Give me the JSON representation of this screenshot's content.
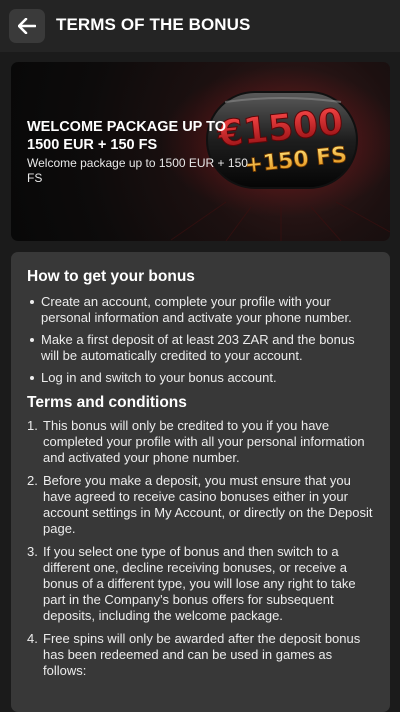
{
  "header": {
    "title": "TERMS OF THE BONUS",
    "back_icon": "arrow-left-icon"
  },
  "banner": {
    "title": "WELCOME PACKAGE UP TO 1500 EUR + 150 FS",
    "subtitle": "Welcome package up to 1500 EUR + 150 FS",
    "art_amount": "€1500",
    "art_fs": "+150 FS"
  },
  "how_to": {
    "title": "How to get your bonus",
    "items": [
      "Create an account, complete your profile with your personal information and activate your phone number.",
      "Make a first deposit of at least 203 ZAR and the bonus will be automatically credited to your account.",
      "Log in and switch to your bonus account."
    ]
  },
  "terms": {
    "title": "Terms and conditions",
    "items": [
      {
        "num": "1.",
        "text": "This bonus will only be credited to you if you have completed your profile with all your personal information and activated your phone number."
      },
      {
        "num": "2.",
        "text": "Before you make a deposit, you must ensure that you have agreed to receive casino bonuses either in your account settings in My Account, or directly on the Deposit page."
      },
      {
        "num": "3.",
        "text": "If you select one type of bonus and then switch to a different one, decline receiving bonuses, or receive a bonus of a different type, you will lose any right to take part in the Company's bonus offers for subsequent deposits, including the welcome package."
      },
      {
        "num": "4.",
        "text": "Free spins will only be awarded after the deposit bonus has been redeemed and can be used in games as follows:"
      }
    ]
  },
  "colors": {
    "background": "#1b1b1b",
    "header": "#242424",
    "card": "#383838",
    "accent_red": "#c0161b",
    "accent_gold": "#f6b62c"
  }
}
